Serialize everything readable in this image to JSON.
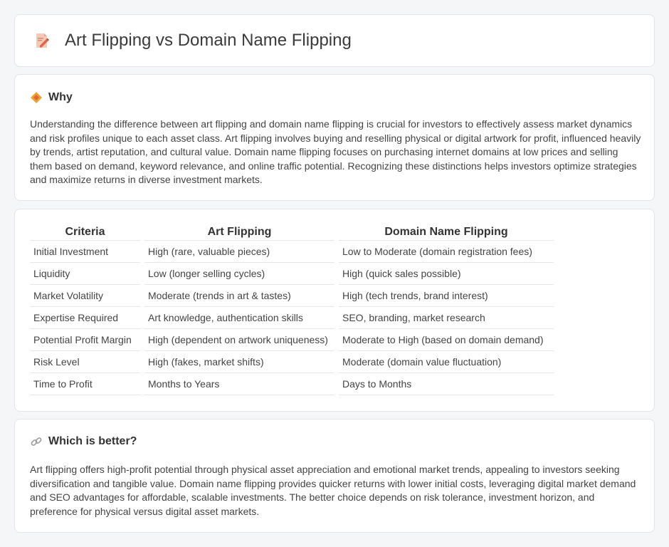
{
  "header": {
    "title": "Art Flipping vs Domain Name Flipping",
    "icon": "document-pencil-icon"
  },
  "why": {
    "heading": "Why",
    "icon": "diamond-icon",
    "text": "Understanding the difference between art flipping and domain name flipping is crucial for investors to effectively assess market dynamics and risk profiles unique to each asset class. Art flipping involves buying and reselling physical or digital artwork for profit, influenced heavily by trends, artist reputation, and cultural value. Domain name flipping focuses on purchasing internet domains at low prices and selling them based on demand, keyword relevance, and online traffic potential. Recognizing these distinctions helps investors optimize strategies and maximize returns in diverse investment markets."
  },
  "table": {
    "headers": [
      "Criteria",
      "Art Flipping",
      "Domain Name Flipping"
    ],
    "rows": [
      [
        "Initial Investment",
        "High (rare, valuable pieces)",
        "Low to Moderate (domain registration fees)"
      ],
      [
        "Liquidity",
        "Low (longer selling cycles)",
        "High (quick sales possible)"
      ],
      [
        "Market Volatility",
        "Moderate (trends in art & tastes)",
        "High (tech trends, brand interest)"
      ],
      [
        "Expertise Required",
        "Art knowledge, authentication skills",
        "SEO, branding, market research"
      ],
      [
        "Potential Profit Margin",
        "High (dependent on artwork uniqueness)",
        "Moderate to High (based on domain demand)"
      ],
      [
        "Risk Level",
        "High (fakes, market shifts)",
        "Moderate (domain value fluctuation)"
      ],
      [
        "Time to Profit",
        "Months to Years",
        "Days to Months"
      ]
    ]
  },
  "better": {
    "heading": "Which is better?",
    "icon": "link-icon",
    "text": "Art flipping offers high-profit potential through physical asset appreciation and emotional market trends, appealing to investors seeking diversification and tangible value. Domain name flipping provides quicker returns with lower initial costs, leveraging digital market demand and SEO advantages for affordable, scalable investments. The better choice depends on risk tolerance, investment horizon, and preference for physical versus digital asset markets."
  },
  "colors": {
    "background": "#f5f6f8",
    "card": "#ffffff",
    "accent_orange": "#f0a030"
  }
}
